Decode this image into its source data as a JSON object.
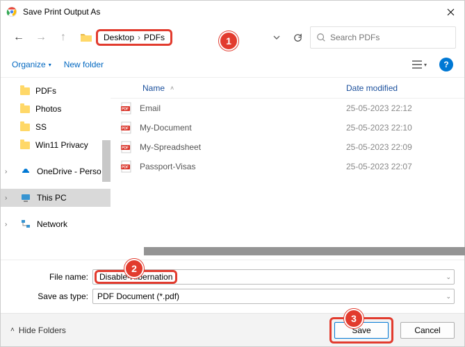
{
  "window": {
    "title": "Save Print Output As"
  },
  "nav": {
    "path": [
      "Desktop",
      "PDFs"
    ],
    "search_placeholder": "Search PDFs"
  },
  "actions": {
    "organize": "Organize",
    "new_folder": "New folder"
  },
  "sidebar": {
    "items": [
      {
        "label": "PDFs",
        "type": "folder"
      },
      {
        "label": "Photos",
        "type": "folder"
      },
      {
        "label": "SS",
        "type": "folder"
      },
      {
        "label": "Win11 Privacy",
        "type": "folder"
      },
      {
        "label": "OneDrive - Perso",
        "type": "onedrive",
        "expandable": true
      },
      {
        "label": "This PC",
        "type": "pc",
        "expandable": true,
        "selected": true
      },
      {
        "label": "Network",
        "type": "network",
        "expandable": true
      }
    ]
  },
  "filelist": {
    "columns": {
      "name": "Name",
      "date": "Date modified"
    },
    "rows": [
      {
        "name": "Email",
        "date": "25-05-2023 22:12"
      },
      {
        "name": "My-Document",
        "date": "25-05-2023 22:10"
      },
      {
        "name": "My-Spreadsheet",
        "date": "25-05-2023 22:09"
      },
      {
        "name": "Passport-Visas",
        "date": "25-05-2023 22:07"
      }
    ]
  },
  "form": {
    "file_name_label": "File name:",
    "file_name_value": "Disable-Hibernation",
    "save_type_label": "Save as type:",
    "save_type_value": "PDF Document (*.pdf)"
  },
  "footer": {
    "hide_folders": "Hide Folders",
    "save": "Save",
    "cancel": "Cancel"
  },
  "callouts": {
    "one": "1",
    "two": "2",
    "three": "3"
  }
}
